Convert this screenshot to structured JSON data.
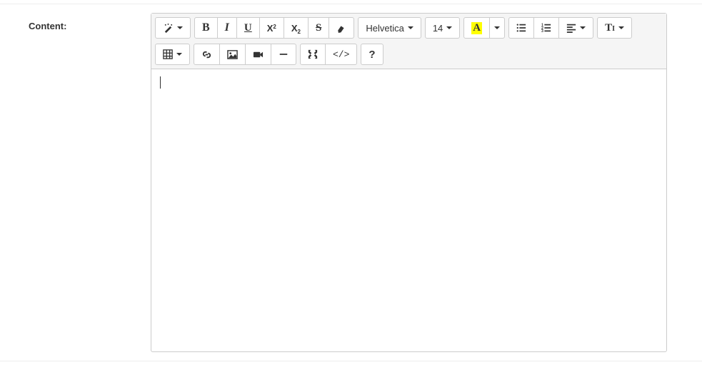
{
  "label": "Content:",
  "toolbar": {
    "style": {
      "magic": "style-dropdown"
    },
    "font": {
      "bold": "B",
      "italic": "I",
      "underline": "U",
      "superscript_main": "X",
      "superscript_sup": "2",
      "subscript_main": "X",
      "subscript_sub": "2",
      "strike": "S"
    },
    "fontname": "Helvetica",
    "fontsize": "14",
    "color": {
      "fore_letter": "A"
    },
    "help": "?",
    "codeview": "</>",
    "paragraph_ti": "T",
    "paragraph_i": "I"
  },
  "content": ""
}
